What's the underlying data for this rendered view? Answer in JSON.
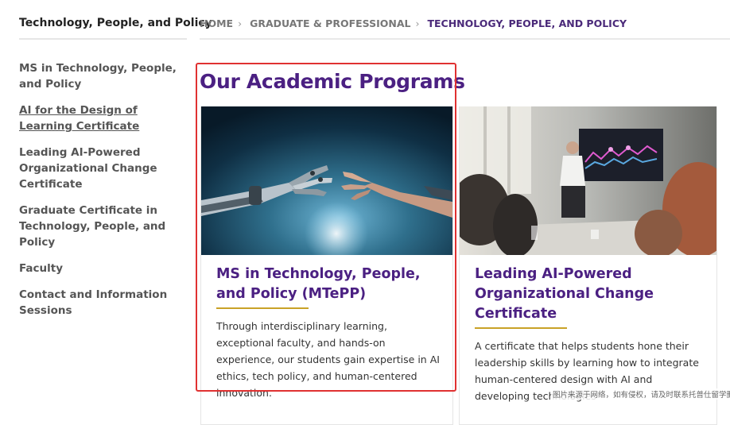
{
  "sidebar": {
    "title": "Technology, People, and Policy",
    "items": [
      {
        "label": "MS in Technology, People, and Policy"
      },
      {
        "label": "AI for the Design of Learning Certificate"
      },
      {
        "label": "Leading AI-Powered Organizational Change Certificate"
      },
      {
        "label": "Graduate Certificate in Technology, People, and Policy"
      },
      {
        "label": "Faculty"
      },
      {
        "label": "Contact and Information Sessions"
      }
    ]
  },
  "breadcrumb": {
    "items": [
      "HOME",
      "GRADUATE & PROFESSIONAL",
      "TECHNOLOGY, PEOPLE, AND POLICY"
    ],
    "separator": "›"
  },
  "main": {
    "heading": "Our Academic Programs",
    "cards": [
      {
        "title": "MS in Technology, People, and Policy (MTePP)",
        "description": "Through interdisciplinary learning, exceptional faculty, and hands-on experience, our students gain expertise in AI ethics, tech policy, and human-centered innovation."
      },
      {
        "title": "Leading AI-Powered Organizational Change Certificate",
        "description": "A certificate that helps students hone their leadership skills by learning how to integrate human-centered design with AI and developing technologies"
      }
    ]
  },
  "watermark": "图片来源于网络，如有侵权，请及时联系托普仕留学删除",
  "colors": {
    "brand_purple": "#4b2082",
    "accent_gold": "#c9a227",
    "highlight_red": "#e03131"
  }
}
